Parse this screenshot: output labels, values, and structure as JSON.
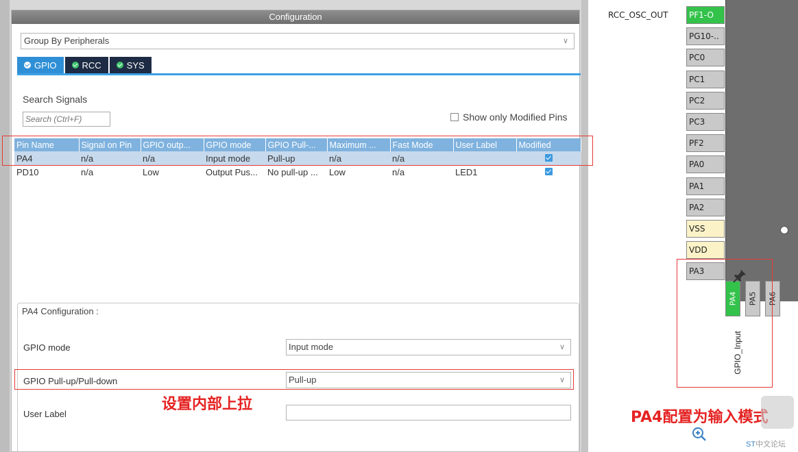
{
  "config": {
    "title": "Configuration",
    "group_by": "Group By Peripherals",
    "tabs": [
      {
        "label": "GPIO",
        "active": true
      },
      {
        "label": "RCC",
        "active": false
      },
      {
        "label": "SYS",
        "active": false
      }
    ],
    "search": {
      "label": "Search Signals",
      "placeholder": "Search (Ctrl+F)"
    },
    "show_modified_label": "Show only Modified Pins",
    "table": {
      "columns": [
        "Pin Name",
        "Signal on Pin",
        "GPIO outp...",
        "GPIO mode",
        "GPIO Pull-...",
        "Maximum ...",
        "Fast Mode",
        "User Label",
        "Modified"
      ],
      "rows": [
        [
          "PA4",
          "n/a",
          "n/a",
          "Input mode",
          "Pull-up",
          "n/a",
          "n/a",
          "",
          true
        ],
        [
          "PD10",
          "n/a",
          "Low",
          "Output Pus...",
          "No pull-up ...",
          "Low",
          "n/a",
          "LED1",
          true
        ]
      ]
    },
    "pa4_config": {
      "legend": "PA4 Configuration :",
      "gpio_mode_label": "GPIO mode",
      "gpio_mode_value": "Input mode",
      "pull_label": "GPIO Pull-up/Pull-down",
      "pull_value": "Pull-up",
      "user_label_label": "User Label",
      "user_label_value": ""
    },
    "annotation": "设置内部上拉"
  },
  "pinout": {
    "osc_label": "RCC_OSC_OUT",
    "pins": [
      {
        "name": "PF1-O",
        "state": "green"
      },
      {
        "name": "PG10-..",
        "state": "grey"
      },
      {
        "name": "PC0",
        "state": "grey"
      },
      {
        "name": "PC1",
        "state": "grey"
      },
      {
        "name": "PC2",
        "state": "grey"
      },
      {
        "name": "PC3",
        "state": "grey"
      },
      {
        "name": "PF2",
        "state": "grey"
      },
      {
        "name": "PA0",
        "state": "grey"
      },
      {
        "name": "PA1",
        "state": "grey"
      },
      {
        "name": "PA2",
        "state": "grey"
      },
      {
        "name": "VSS",
        "state": "yellow"
      },
      {
        "name": "VDD",
        "state": "yellow"
      },
      {
        "name": "PA3",
        "state": "grey"
      }
    ],
    "bottom_pins": [
      {
        "name": "PA4",
        "state": "green"
      },
      {
        "name": "PA5",
        "state": "grey"
      },
      {
        "name": "PA6",
        "state": "grey"
      }
    ],
    "pa4_signal": "GPIO_Input",
    "annotation": "PA4配置为输入模式"
  },
  "watermark": {
    "brand": "ST",
    "text": "中文论坛"
  },
  "colors": {
    "accent": "#2f8fd6",
    "pin_green": "#33c24a",
    "annotation_red": "#e52222"
  }
}
